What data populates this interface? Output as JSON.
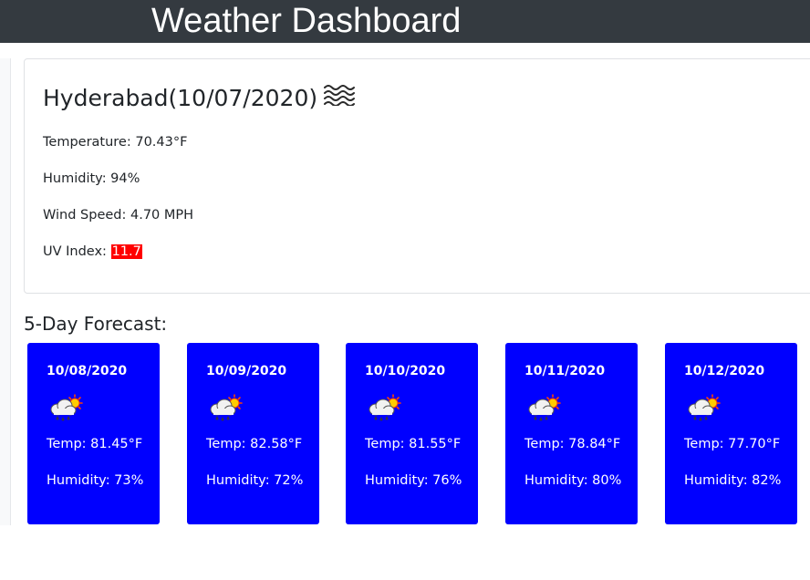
{
  "header": {
    "title": "Weather Dashboard"
  },
  "current": {
    "city_heading": "Hyderabad(10/07/2020)",
    "icon": "mist-icon",
    "temperature": "Temperature: 70.43°F",
    "humidity": "Humidity: 94%",
    "wind_speed": "Wind Speed: 4.70 MPH",
    "uv_label": "UV Index: ",
    "uv_value": "11.7",
    "uv_color": "#ff0000"
  },
  "forecast": {
    "title": "5-Day Forecast:",
    "card_color": "#0000ff",
    "days": [
      {
        "date": "10/08/2020",
        "icon": "rain-sun-cloud-icon",
        "temp": "Temp: 81.45°F",
        "humidity": "Humidity: 73%"
      },
      {
        "date": "10/09/2020",
        "icon": "rain-sun-cloud-icon",
        "temp": "Temp: 82.58°F",
        "humidity": "Humidity: 72%"
      },
      {
        "date": "10/10/2020",
        "icon": "rain-sun-cloud-icon",
        "temp": "Temp: 81.55°F",
        "humidity": "Humidity: 76%"
      },
      {
        "date": "10/11/2020",
        "icon": "rain-sun-cloud-icon",
        "temp": "Temp: 78.84°F",
        "humidity": "Humidity: 80%"
      },
      {
        "date": "10/12/2020",
        "icon": "rain-sun-cloud-icon",
        "temp": "Temp: 77.70°F",
        "humidity": "Humidity: 82%"
      }
    ]
  }
}
